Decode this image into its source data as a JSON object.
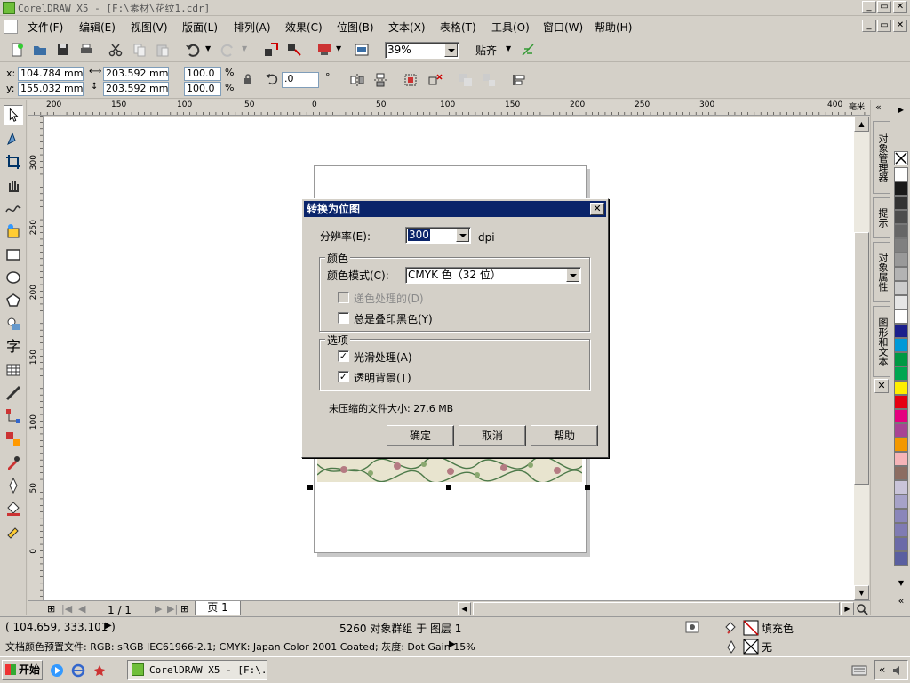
{
  "app": {
    "title": "CorelDRAW X5 - [F:\\素材\\花纹1.cdr]"
  },
  "menu": [
    "文件(F)",
    "编辑(E)",
    "视图(V)",
    "版面(L)",
    "排列(A)",
    "效果(C)",
    "位图(B)",
    "文本(X)",
    "表格(T)",
    "工具(O)",
    "窗口(W)",
    "帮助(H)"
  ],
  "toolbar": {
    "zoom": "39%",
    "snap_label": "贴齐"
  },
  "props": {
    "x_label": "x:",
    "y_label": "y:",
    "x": "104.784 mm",
    "y": "155.032 mm",
    "width": "203.592 mm",
    "height": "203.592 mm",
    "scale_w": "100.0",
    "scale_h": "100.0",
    "percent": "%",
    "angle": ".0",
    "degree": "°"
  },
  "ruler": {
    "unit": "毫米",
    "h_ticks": [
      "200",
      "150",
      "100",
      "50",
      "0",
      "50",
      "100",
      "150",
      "200",
      "250",
      "300",
      "400"
    ],
    "v_ticks": [
      "300",
      "250",
      "200",
      "150",
      "100",
      "50",
      "0"
    ]
  },
  "page_nav": {
    "count": "1 / 1",
    "tab": "页 1"
  },
  "dialog": {
    "title": "转换为位图",
    "resolution_label": "分辨率(E):",
    "resolution_value": "300",
    "dpi": "dpi",
    "color_group": "颜色",
    "color_mode_label": "颜色模式(C):",
    "color_mode_value": "CMYK 色（32 位）",
    "dither_label": "递色处理的(D)",
    "overprint_label": "总是叠印黑色(Y)",
    "options_group": "选项",
    "antialias_label": "光滑处理(A)",
    "transparent_label": "透明背景(T)",
    "filesize_label": "未压缩的文件大小: 27.6 MB",
    "ok": "确定",
    "cancel": "取消",
    "help": "帮助"
  },
  "docker_tabs": [
    "对象管理器",
    "提示",
    "对象属性",
    "图形和文本"
  ],
  "palette": [
    "#ffffff",
    "#1a1a1a",
    "#333333",
    "#4d4d4d",
    "#666666",
    "#808080",
    "#999999",
    "#b3b3b3",
    "#cccccc",
    "#e6e6e6",
    "#ffffff",
    "#1b1f8c",
    "#0099d8",
    "#009944",
    "#00a651",
    "#ffee00",
    "#e60012",
    "#e4007f",
    "#a84493",
    "#f39800",
    "#f5b4b8",
    "#8c6d62",
    "#c9c4d9",
    "#a6a2c8",
    "#8a86ba",
    "#7f7bb3",
    "#6b6aa8",
    "#5a5fa0"
  ],
  "status": {
    "coords": "( 104.659, 333.101 )",
    "selection": "5260 对象群组 于 图层 1",
    "fill_label": "填充色",
    "outline_label": "无",
    "color_profile": "文档颜色预置文件: RGB: sRGB IEC61966-2.1; CMYK: Japan Color 2001 Coated; 灰度: Dot Gain 15%"
  },
  "taskbar": {
    "start": "开始",
    "task": "CorelDRAW X5 - [F:\\..."
  }
}
